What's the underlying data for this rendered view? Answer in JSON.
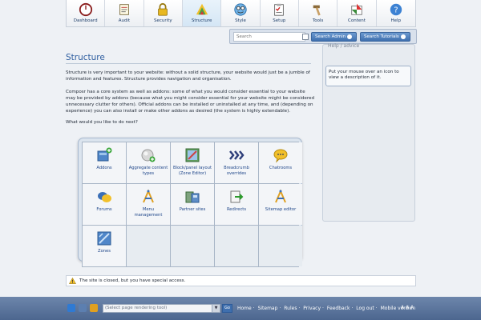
{
  "nav": {
    "tabs": [
      {
        "label": "Dashboard",
        "icon": "dashboard-icon"
      },
      {
        "label": "Audit",
        "icon": "audit-icon"
      },
      {
        "label": "Security",
        "icon": "lock-icon"
      },
      {
        "label": "Structure",
        "icon": "structure-icon",
        "active": true
      },
      {
        "label": "Style",
        "icon": "style-icon"
      },
      {
        "label": "Setup",
        "icon": "setup-icon"
      },
      {
        "label": "Tools",
        "icon": "tools-icon"
      },
      {
        "label": "Content",
        "icon": "content-icon"
      },
      {
        "label": "Help",
        "icon": "help-icon"
      }
    ]
  },
  "search": {
    "placeholder": "Search",
    "admin_label": "Search Admin",
    "tutorials_label": "Search Tutorials"
  },
  "main": {
    "title": "Structure",
    "paragraph1": "Structure is very important to your website: without a solid structure, your website would just be a jumble of information and features. Structure provides navigation and organisation.",
    "paragraph2": "Composr has a core system as well as addons: some of what you would consider essential to your website may be provided by addons (because what you might consider essential for your website might be considered unnecessary clutter for others). Official addons can be installed or uninstalled at any time, and (depending on experience) you can also install or make other addons as desired (the system is highly extendable).",
    "question": "What would you like to do next?"
  },
  "helper": {
    "title": "Help / advice",
    "text": "Put your mouse over an icon to view a description of it."
  },
  "grid": {
    "items": [
      {
        "label": "Addons",
        "icon": "addons-icon"
      },
      {
        "label": "Aggregate content types",
        "icon": "aggregate-icon"
      },
      {
        "label": "Block/panel layout (Zone Editor)",
        "icon": "zone-editor-icon"
      },
      {
        "label": "Breadcrumb overrides",
        "icon": "breadcrumb-icon"
      },
      {
        "label": "Chatrooms",
        "icon": "chat-icon"
      },
      {
        "label": "Forums",
        "icon": "forums-icon"
      },
      {
        "label": "Menu management",
        "icon": "menu-icon"
      },
      {
        "label": "Partner sites",
        "icon": "partner-icon"
      },
      {
        "label": "Redirects",
        "icon": "redirect-icon"
      },
      {
        "label": "Sitemap editor",
        "icon": "sitemap-icon"
      },
      {
        "label": "Zones",
        "icon": "zones-icon"
      }
    ]
  },
  "notice": {
    "text": "The site is closed, but you have special access."
  },
  "footer": {
    "select_placeholder": "(Select page rendering tool)",
    "go_label": "Go",
    "links": [
      "Home",
      "Sitemap",
      "Rules",
      "Privacy",
      "Feedback",
      "Log out",
      "Mobile version"
    ],
    "font_sizes": "A A A"
  },
  "colors": {
    "accent": "#2e5ea0",
    "footer": "#566f96",
    "button": "#4c7abd"
  }
}
